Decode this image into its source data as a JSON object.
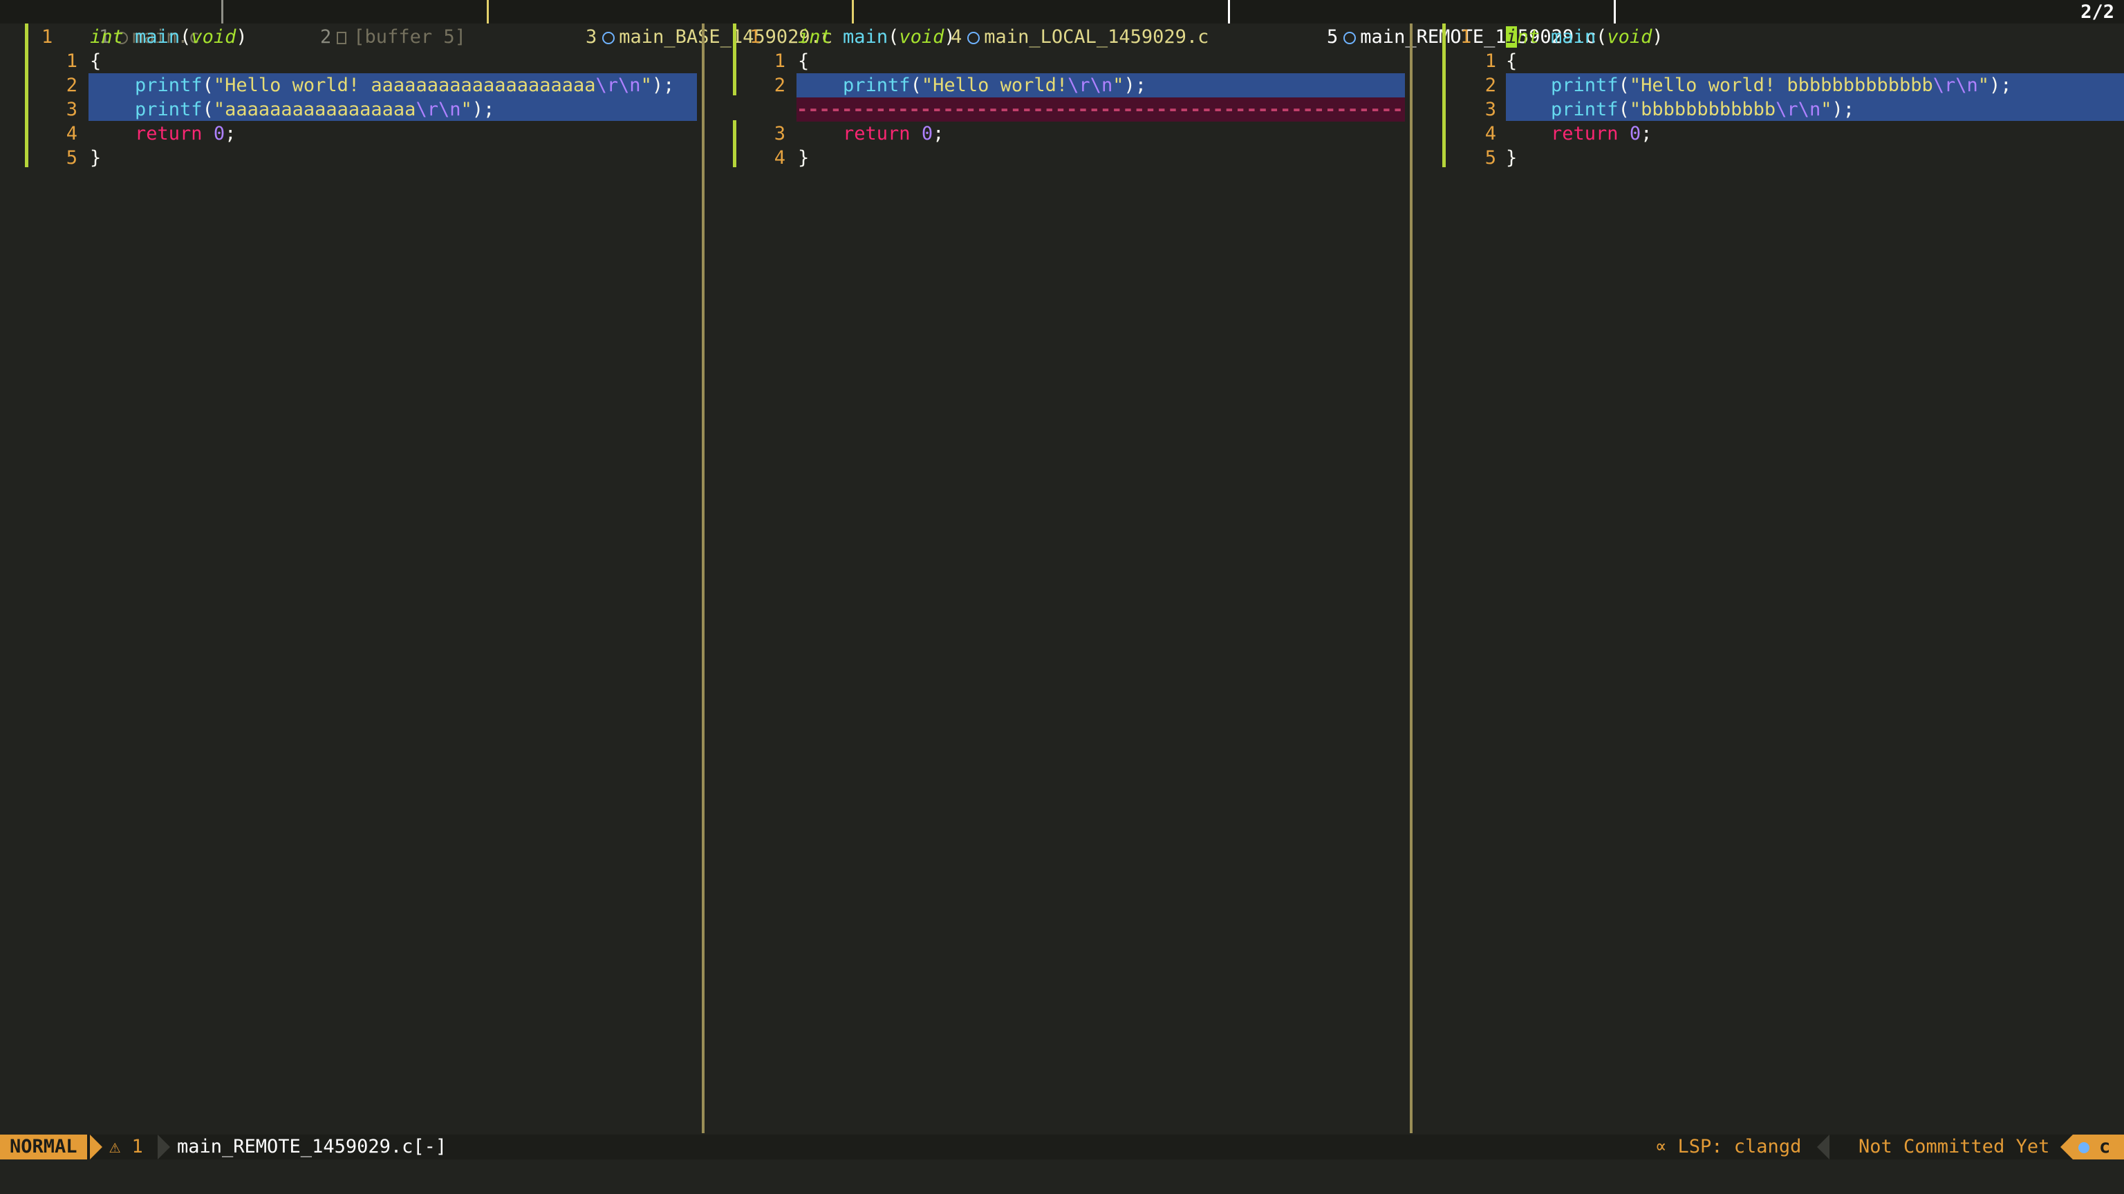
{
  "tabline": {
    "tabs": [
      {
        "number": "1",
        "name": "main.c",
        "icon": "c-file-icon"
      },
      {
        "number": "2",
        "name": "[buffer 5]",
        "icon": "document-icon"
      },
      {
        "number": "3",
        "name": "main_BASE_1459029.c",
        "icon": "c-file-icon"
      },
      {
        "number": "4",
        "name": "main_LOCAL_1459029.c",
        "icon": "c-file-icon"
      },
      {
        "number": "5",
        "name": "main_REMOTE_1459029.c",
        "icon": "c-file-icon"
      }
    ],
    "tab_count": "2/2"
  },
  "panes": [
    {
      "file": "main_BASE_1459029.c",
      "lines": [
        {
          "num": "1",
          "text": "int main(void)"
        },
        {
          "num": "1",
          "text": "{"
        },
        {
          "num": "2",
          "text": "    printf(\"Hello world! aaaaaaaaaaaaaaaaaaaa\\r\\n\");"
        },
        {
          "num": "3",
          "text": "    printf(\"aaaaaaaaaaaaaaaaa\\r\\n\");"
        },
        {
          "num": "4",
          "text": "    return 0;"
        },
        {
          "num": "5",
          "text": "}"
        }
      ]
    },
    {
      "file": "main_LOCAL_1459029.c",
      "lines": [
        {
          "num": "1",
          "text": "int main(void)"
        },
        {
          "num": "1",
          "text": "{"
        },
        {
          "num": "2",
          "text": "    printf(\"Hello world!\\r\\n\");"
        },
        {
          "num": "",
          "text": "deleted"
        },
        {
          "num": "3",
          "text": "    return 0;"
        },
        {
          "num": "4",
          "text": "}"
        }
      ]
    },
    {
      "file": "main_REMOTE_1459029.c",
      "lines": [
        {
          "num": "1",
          "text": "int main(void)"
        },
        {
          "num": "1",
          "text": "{"
        },
        {
          "num": "2",
          "text": "    printf(\"Hello world! bbbbbbbbbbbbb\\r\\n\");"
        },
        {
          "num": "3",
          "text": "    printf(\"bbbbbbbbbbbb\\r\\n\");"
        },
        {
          "num": "4",
          "text": "    return 0;"
        },
        {
          "num": "5",
          "text": "}"
        }
      ]
    }
  ],
  "statusline": {
    "mode": "NORMAL",
    "warnings": "⚠ 1",
    "filename": "main_REMOTE_1459029.c[-]",
    "lsp": "LSP: clangd",
    "git": "Not Committed Yet",
    "filetype": "c"
  },
  "colors": {
    "background": "#22231f",
    "mode_bg": "#e39b36",
    "diff_change": "#2f4f8f",
    "diff_delete": "#4b0f2a",
    "gutter_bar": "#b6d53a",
    "line_number": "#e6a340"
  }
}
